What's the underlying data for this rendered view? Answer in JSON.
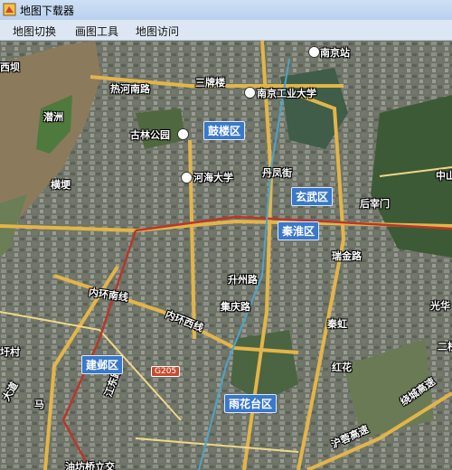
{
  "window": {
    "title": "地图下载器"
  },
  "menu": {
    "items": [
      "地图切换",
      "画图工具",
      "地图访问"
    ]
  },
  "map": {
    "districts": [
      "鼓楼区",
      "玄武区",
      "秦淮区",
      "建邺区",
      "雨花台区"
    ],
    "places": [
      "南京站",
      "三牌楼",
      "热河南路",
      "南京工业大学",
      "古林公园",
      "河海大学",
      "丹凤街",
      "后宰门",
      "瑞金路",
      "升州路",
      "集庆路",
      "秦虹",
      "红花",
      "西坝",
      "潜洲",
      "横埂",
      "中山",
      "光华",
      "二桥",
      "内环南线",
      "内环西线",
      "沪蓉高速",
      "绕城高速",
      "江东路",
      "马",
      "大道",
      "圩村",
      "油坊桥立交"
    ],
    "road_badge": "G205"
  }
}
